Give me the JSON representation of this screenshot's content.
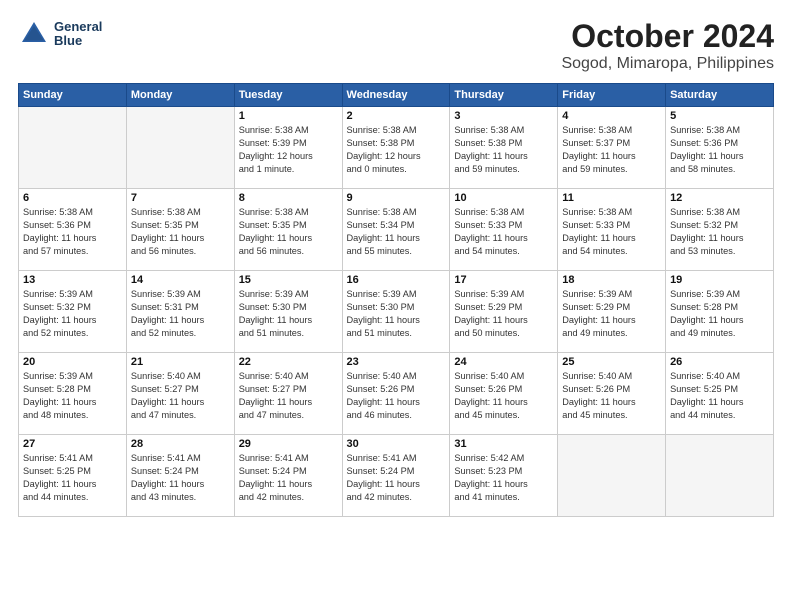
{
  "header": {
    "logo_line1": "General",
    "logo_line2": "Blue",
    "title": "October 2024",
    "subtitle": "Sogod, Mimaropa, Philippines"
  },
  "weekdays": [
    "Sunday",
    "Monday",
    "Tuesday",
    "Wednesday",
    "Thursday",
    "Friday",
    "Saturday"
  ],
  "weeks": [
    [
      {
        "day": "",
        "info": ""
      },
      {
        "day": "",
        "info": ""
      },
      {
        "day": "1",
        "info": "Sunrise: 5:38 AM\nSunset: 5:39 PM\nDaylight: 12 hours\nand 1 minute."
      },
      {
        "day": "2",
        "info": "Sunrise: 5:38 AM\nSunset: 5:38 PM\nDaylight: 12 hours\nand 0 minutes."
      },
      {
        "day": "3",
        "info": "Sunrise: 5:38 AM\nSunset: 5:38 PM\nDaylight: 11 hours\nand 59 minutes."
      },
      {
        "day": "4",
        "info": "Sunrise: 5:38 AM\nSunset: 5:37 PM\nDaylight: 11 hours\nand 59 minutes."
      },
      {
        "day": "5",
        "info": "Sunrise: 5:38 AM\nSunset: 5:36 PM\nDaylight: 11 hours\nand 58 minutes."
      }
    ],
    [
      {
        "day": "6",
        "info": "Sunrise: 5:38 AM\nSunset: 5:36 PM\nDaylight: 11 hours\nand 57 minutes."
      },
      {
        "day": "7",
        "info": "Sunrise: 5:38 AM\nSunset: 5:35 PM\nDaylight: 11 hours\nand 56 minutes."
      },
      {
        "day": "8",
        "info": "Sunrise: 5:38 AM\nSunset: 5:35 PM\nDaylight: 11 hours\nand 56 minutes."
      },
      {
        "day": "9",
        "info": "Sunrise: 5:38 AM\nSunset: 5:34 PM\nDaylight: 11 hours\nand 55 minutes."
      },
      {
        "day": "10",
        "info": "Sunrise: 5:38 AM\nSunset: 5:33 PM\nDaylight: 11 hours\nand 54 minutes."
      },
      {
        "day": "11",
        "info": "Sunrise: 5:38 AM\nSunset: 5:33 PM\nDaylight: 11 hours\nand 54 minutes."
      },
      {
        "day": "12",
        "info": "Sunrise: 5:38 AM\nSunset: 5:32 PM\nDaylight: 11 hours\nand 53 minutes."
      }
    ],
    [
      {
        "day": "13",
        "info": "Sunrise: 5:39 AM\nSunset: 5:32 PM\nDaylight: 11 hours\nand 52 minutes."
      },
      {
        "day": "14",
        "info": "Sunrise: 5:39 AM\nSunset: 5:31 PM\nDaylight: 11 hours\nand 52 minutes."
      },
      {
        "day": "15",
        "info": "Sunrise: 5:39 AM\nSunset: 5:30 PM\nDaylight: 11 hours\nand 51 minutes."
      },
      {
        "day": "16",
        "info": "Sunrise: 5:39 AM\nSunset: 5:30 PM\nDaylight: 11 hours\nand 51 minutes."
      },
      {
        "day": "17",
        "info": "Sunrise: 5:39 AM\nSunset: 5:29 PM\nDaylight: 11 hours\nand 50 minutes."
      },
      {
        "day": "18",
        "info": "Sunrise: 5:39 AM\nSunset: 5:29 PM\nDaylight: 11 hours\nand 49 minutes."
      },
      {
        "day": "19",
        "info": "Sunrise: 5:39 AM\nSunset: 5:28 PM\nDaylight: 11 hours\nand 49 minutes."
      }
    ],
    [
      {
        "day": "20",
        "info": "Sunrise: 5:39 AM\nSunset: 5:28 PM\nDaylight: 11 hours\nand 48 minutes."
      },
      {
        "day": "21",
        "info": "Sunrise: 5:40 AM\nSunset: 5:27 PM\nDaylight: 11 hours\nand 47 minutes."
      },
      {
        "day": "22",
        "info": "Sunrise: 5:40 AM\nSunset: 5:27 PM\nDaylight: 11 hours\nand 47 minutes."
      },
      {
        "day": "23",
        "info": "Sunrise: 5:40 AM\nSunset: 5:26 PM\nDaylight: 11 hours\nand 46 minutes."
      },
      {
        "day": "24",
        "info": "Sunrise: 5:40 AM\nSunset: 5:26 PM\nDaylight: 11 hours\nand 45 minutes."
      },
      {
        "day": "25",
        "info": "Sunrise: 5:40 AM\nSunset: 5:26 PM\nDaylight: 11 hours\nand 45 minutes."
      },
      {
        "day": "26",
        "info": "Sunrise: 5:40 AM\nSunset: 5:25 PM\nDaylight: 11 hours\nand 44 minutes."
      }
    ],
    [
      {
        "day": "27",
        "info": "Sunrise: 5:41 AM\nSunset: 5:25 PM\nDaylight: 11 hours\nand 44 minutes."
      },
      {
        "day": "28",
        "info": "Sunrise: 5:41 AM\nSunset: 5:24 PM\nDaylight: 11 hours\nand 43 minutes."
      },
      {
        "day": "29",
        "info": "Sunrise: 5:41 AM\nSunset: 5:24 PM\nDaylight: 11 hours\nand 42 minutes."
      },
      {
        "day": "30",
        "info": "Sunrise: 5:41 AM\nSunset: 5:24 PM\nDaylight: 11 hours\nand 42 minutes."
      },
      {
        "day": "31",
        "info": "Sunrise: 5:42 AM\nSunset: 5:23 PM\nDaylight: 11 hours\nand 41 minutes."
      },
      {
        "day": "",
        "info": ""
      },
      {
        "day": "",
        "info": ""
      }
    ]
  ]
}
